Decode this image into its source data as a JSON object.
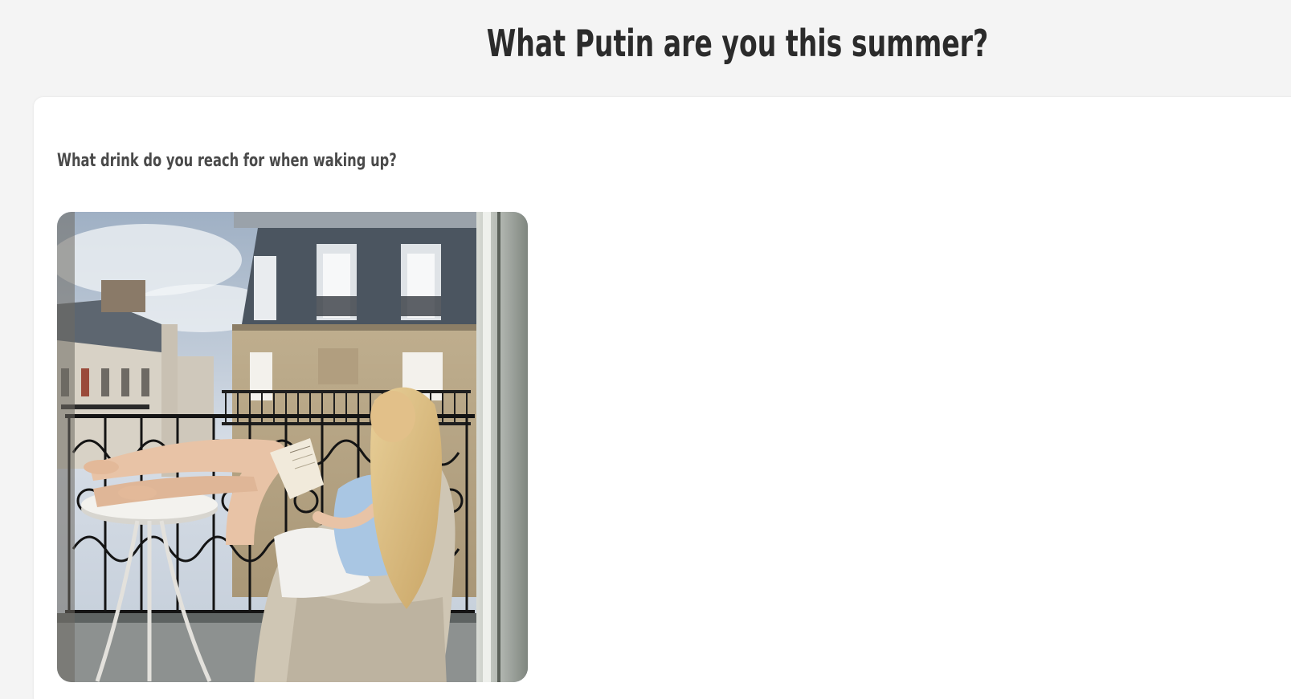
{
  "header": {
    "title": "What Putin are you this summer?"
  },
  "question": {
    "text": "What drink do you reach for when waking up?",
    "image": {
      "icon": "photo-woman-reading-on-paris-balcony"
    }
  },
  "colors": {
    "page_background": "#f4f4f4",
    "card_background": "#ffffff",
    "title_text": "#2b2b2b",
    "question_text": "#4a4a4a"
  }
}
